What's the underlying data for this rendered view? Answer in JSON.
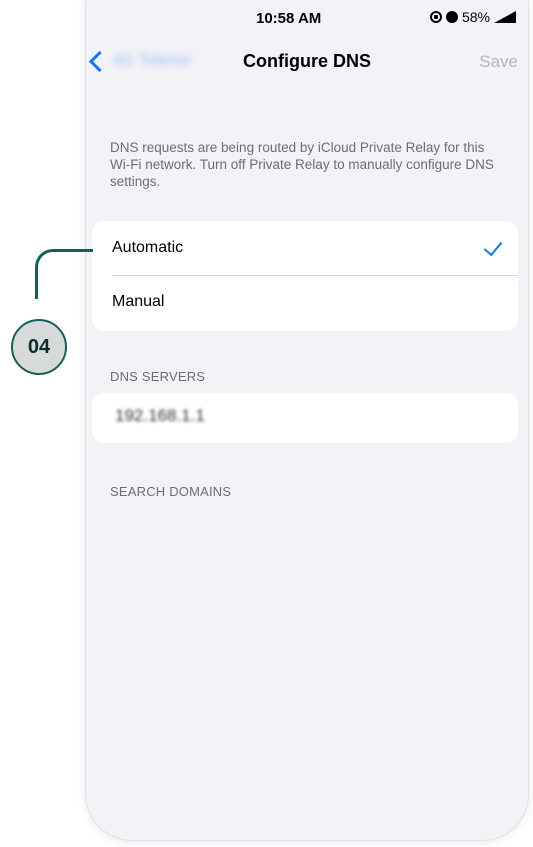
{
  "status_bar": {
    "time": "10:58 AM",
    "battery": "58%"
  },
  "nav": {
    "back_label": "4G Telenor",
    "title": "Configure DNS",
    "save_label": "Save"
  },
  "private_relay_note": "DNS requests are being routed by iCloud Private Relay for this Wi-Fi network. Turn off Private Relay to manually configure DNS settings.",
  "dns_mode": {
    "options": [
      {
        "label": "Automatic",
        "selected": true
      },
      {
        "label": "Manual",
        "selected": false
      }
    ]
  },
  "dns_servers": {
    "header": "DNS SERVERS",
    "items": [
      "192.168.1.1"
    ]
  },
  "search_domains": {
    "header": "SEARCH DOMAINS"
  },
  "callout": {
    "label": "04"
  },
  "colors": {
    "accent": "#1477f8",
    "callout": "#155f5a",
    "background": "#f2f2f7"
  },
  "icons": [
    "orientation-lock-icon",
    "alarm-icon",
    "battery-icon",
    "chevron-left-icon",
    "checkmark-icon"
  ]
}
